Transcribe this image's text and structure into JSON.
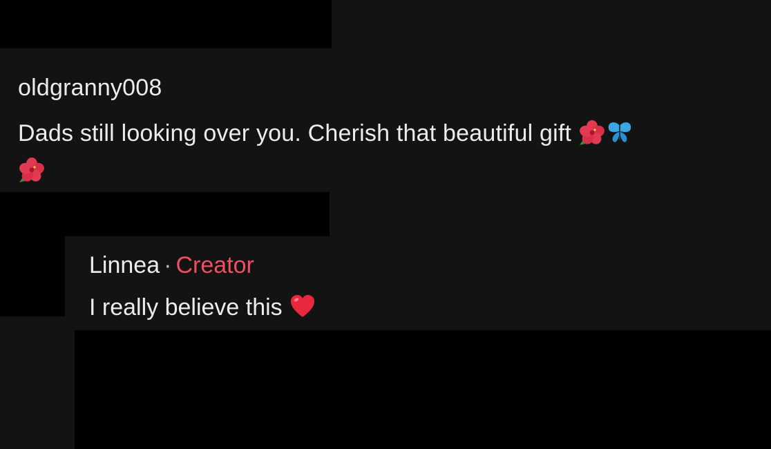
{
  "comment": {
    "username": "oldgranny008",
    "text": "Dads still looking over you. Cherish that beautiful gift",
    "trailing_emojis": [
      "hibiscus-icon",
      "butterfly-icon",
      "hibiscus-icon"
    ]
  },
  "reply": {
    "username": "Linnea",
    "separator": "·",
    "role_label": "Creator",
    "text": "I really believe this",
    "trailing_emoji": "red-heart-icon"
  },
  "colors": {
    "background": "#131313",
    "text": "#ececec",
    "creator_accent": "#ee4f61",
    "redaction": "#000000"
  }
}
